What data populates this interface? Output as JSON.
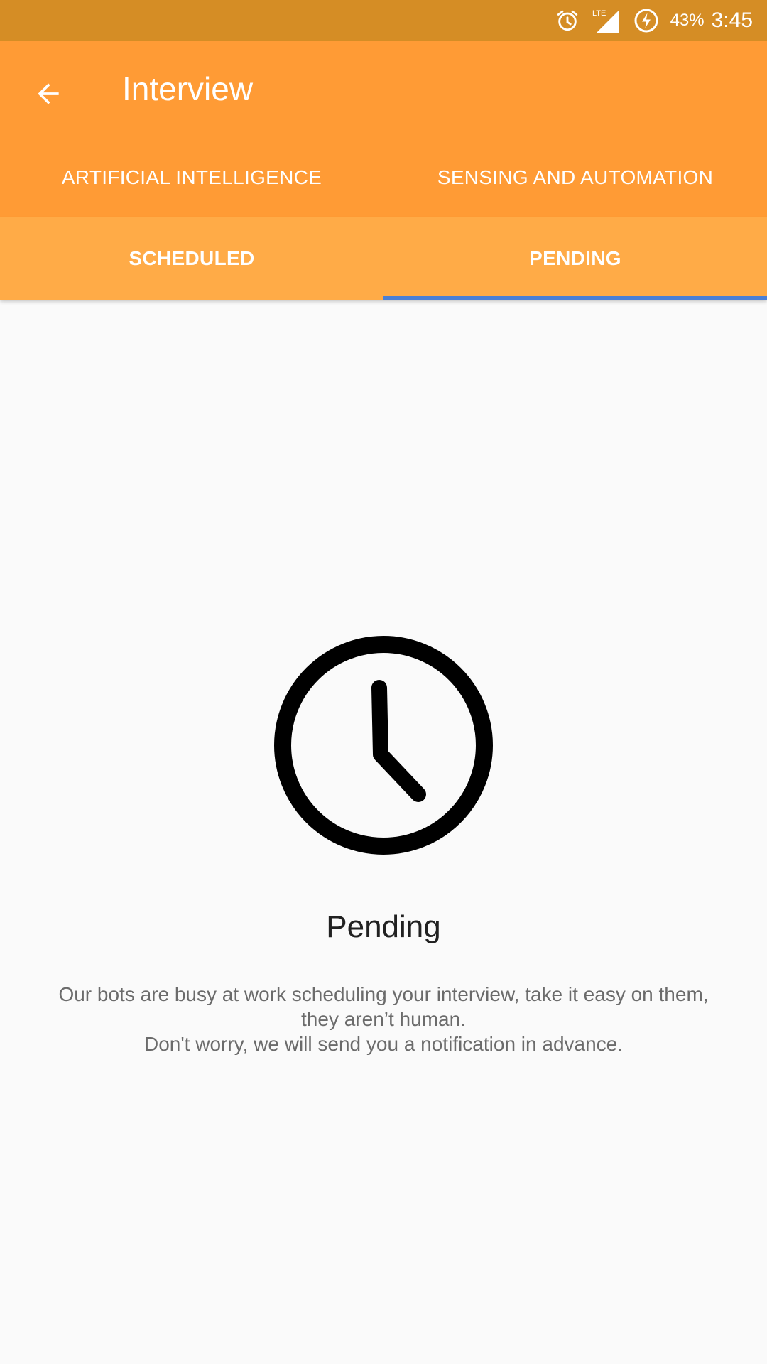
{
  "status_bar": {
    "icons": [
      "alarm-icon",
      "lte-signal-icon",
      "battery-charging-icon"
    ],
    "network_label": "LTE",
    "battery_percent": "43%",
    "time": "3:45"
  },
  "toolbar": {
    "title": "Interview",
    "back_icon": "arrow-back-icon"
  },
  "top_tabs": [
    {
      "label": "ARTIFICIAL INTELLIGENCE"
    },
    {
      "label": "SENSING AND AUTOMATION"
    }
  ],
  "sub_tabs": [
    {
      "label": "SCHEDULED",
      "selected": false
    },
    {
      "label": "PENDING",
      "selected": true
    }
  ],
  "empty_state": {
    "icon": "clock-icon",
    "title": "Pending",
    "message_line1": "Our bots are busy at work scheduling your interview, take it easy on them,",
    "message_line2": "they aren’t human.",
    "message_line3": "Don't worry, we will send you a notification in advance."
  },
  "colors": {
    "status_bar": "#d58d25",
    "app_bar": "#ff9b35",
    "sub_tabs": "#ffab47",
    "tab_indicator": "#4a7fd6",
    "background": "#fafafa"
  }
}
